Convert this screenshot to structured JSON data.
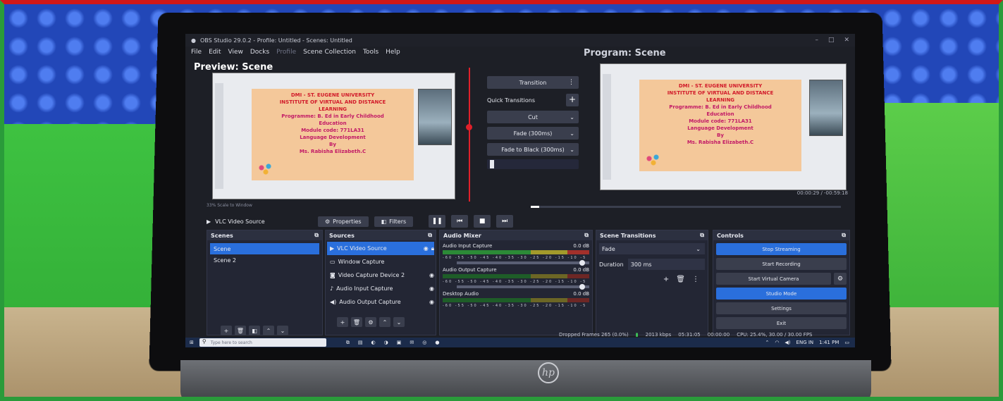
{
  "window": {
    "title": "OBS Studio 29.0.2 - Profile: Untitled - Scenes: Untitled",
    "controls": [
      "–",
      "□",
      "✕"
    ]
  },
  "menu": [
    "File",
    "Edit",
    "View",
    "Docks",
    "Profile",
    "Scene Collection",
    "Tools",
    "Help"
  ],
  "preview": {
    "label": "Preview: Scene",
    "scale_label": "33%   Scale to Window"
  },
  "program": {
    "label": "Program: Scene",
    "timecode": "00:00:29 / -00:59:18"
  },
  "slide": {
    "lines": [
      "DMI - ST. EUGENE UNIVERSITY",
      "INSTITUTE OF VIRTUAL AND DISTANCE",
      "LEARNING",
      "Programme: B. Ed in Early Childhood",
      "Education",
      "Module code: 771LA31",
      "Language Development",
      "By",
      "Ms. Rabisha Elizabeth.C"
    ]
  },
  "transitions": {
    "transition_label": "Transition",
    "quick_label": "Quick Transitions",
    "options": [
      "Cut",
      "Fade (300ms)",
      "Fade to Black (300ms)"
    ]
  },
  "source_bar": {
    "source_name": "VLC Video Source",
    "properties": "Properties",
    "filters": "Filters"
  },
  "scenes": {
    "title": "Scenes",
    "items": [
      "Scene",
      "Scene 2"
    ]
  },
  "sources": {
    "title": "Sources",
    "items": [
      "VLC Video Source",
      "Window Capture",
      "Video Capture Device 2",
      "Audio Input Capture",
      "Audio Output Capture"
    ]
  },
  "mixer": {
    "title": "Audio Mixer",
    "channels": [
      {
        "name": "Audio Input Capture",
        "db": "0.0 dB"
      },
      {
        "name": "Audio Output Capture",
        "db": "0.0 dB"
      },
      {
        "name": "Desktop Audio",
        "db": "0.0 dB"
      }
    ],
    "ticks": "-60 -55 -50 -45 -40 -35 -30 -25 -20 -15 -10 -5 0"
  },
  "scene_transitions": {
    "title": "Scene Transitions",
    "selected": "Fade",
    "duration_label": "Duration",
    "duration_value": "300 ms"
  },
  "controls": {
    "title": "Controls",
    "stop_streaming": "Stop Streaming",
    "start_recording": "Start Recording",
    "start_virtual_camera": "Start Virtual Camera",
    "studio_mode": "Studio Mode",
    "settings": "Settings",
    "exit": "Exit"
  },
  "status": {
    "dropped": "Dropped Frames 265 (0.0%)",
    "bitrate": "2013 kbps",
    "live_time": "05:31:05",
    "rec_time": "00:00:00",
    "cpu": "CPU: 25.4%, 30.00 / 30.00 FPS"
  },
  "taskbar": {
    "search_placeholder": "Type here to search",
    "lang": "ENG IN",
    "clock": "1:41 PM"
  },
  "hardware": {
    "brand": "hp"
  },
  "colors": {
    "accent_blue": "#2a6fdc",
    "record_red": "#e0202a",
    "frame_red": "#d01818",
    "frame_green": "#2a9b3a"
  }
}
